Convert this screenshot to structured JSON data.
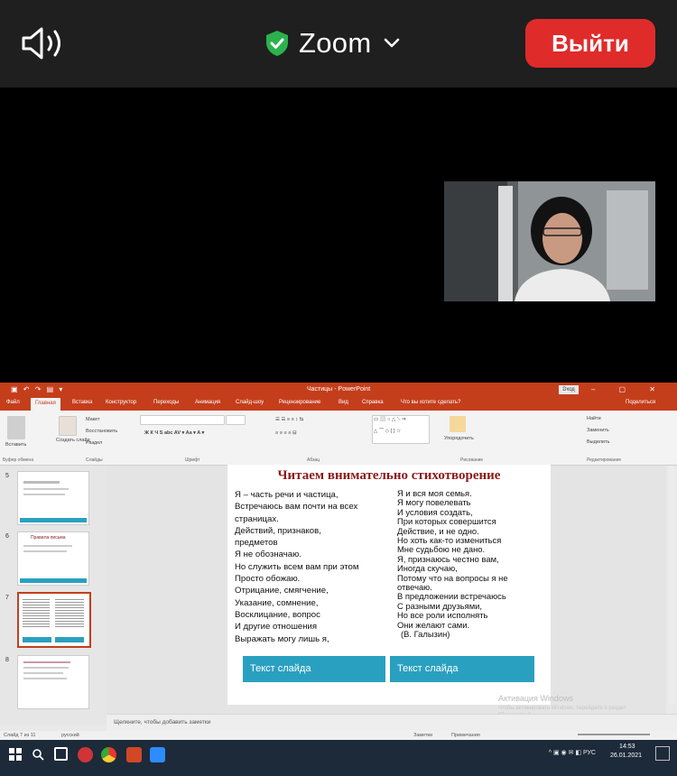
{
  "zoom": {
    "title": "Zoom",
    "leave_label": "Выйти",
    "colors": {
      "bar": "#1f1f1f",
      "leave": "#e02b2b",
      "shield": "#2bb24c"
    },
    "icons": [
      "speaker-icon",
      "shield-check-icon",
      "chevron-down-icon"
    ]
  },
  "powerpoint": {
    "window_title": "Частицы - PowerPoint",
    "login_label": "Вход",
    "tabs": [
      "Файл",
      "Главная",
      "Вставка",
      "Конструктор",
      "Переходы",
      "Анимация",
      "Слайд-шоу",
      "Рецензирование",
      "Вид",
      "Справка",
      "Что вы хотите сделать?"
    ],
    "share_label": "Поделиться",
    "ribbon": {
      "paste": "Вставить",
      "new_slide": "Создать слайд",
      "layout": "Макет",
      "reset": "Восстановить",
      "section": "Раздел",
      "arrange": "Упорядочить",
      "find": "Найти",
      "replace": "Заменить",
      "select": "Выделить",
      "groups": [
        "Буфер обмена",
        "Слайды",
        "Шрифт",
        "Абзац",
        "Рисование",
        "Редактирование"
      ]
    },
    "thumbs": [
      "5",
      "6",
      "7",
      "8"
    ],
    "thumb6_title": "Правила письма",
    "slide": {
      "title": "Читаем внимательно стихотворение",
      "left_lines": [
        "Я – часть речи и частица,",
        "Встречаюсь вам почти на всех",
        "страницах.",
        "Действий, признаков,",
        "предметов",
        "Я не обозначаю.",
        "Но служить всем вам при этом",
        "Просто обожаю.",
        "Отрицание, смягчение,",
        "Указание, сомнение,",
        "Восклицание, вопрос",
        "И другие отношения",
        "Выражать могу лишь я,"
      ],
      "right_lines": [
        "Я и вся моя семья.",
        "Я могу повелевать",
        "И условия создать,",
        "При которых совершится",
        "Действие, и не одно.",
        "Но хоть как-то измениться",
        "Мне судьбою не дано.",
        "Я, признаюсь честно вам,",
        "Иногда скучаю,",
        "Потому что на вопросы я не",
        "отвечаю.",
        "В предложении встречаюсь",
        "С разными друзьями,",
        "Но все роли исполнять",
        "Они желают сами.",
        "(В. Галызин)"
      ],
      "button1": "Текст слайда",
      "button2": "Текст слайда",
      "colors": {
        "title": "#8b1a1a",
        "button": "#2aa0c0"
      }
    },
    "notes_placeholder": "Щелкните, чтобы добавить заметки",
    "watermark": "Активация Windows",
    "watermark_sub": "Чтобы активировать Windows, перейдите в раздел \"Параметры\".",
    "status": {
      "slide": "Слайд 7 из 11",
      "lang": "русский",
      "notes": "Заметки",
      "comments": "Примечания"
    },
    "clock": {
      "time": "14:53",
      "date": "26.01.2021"
    }
  }
}
